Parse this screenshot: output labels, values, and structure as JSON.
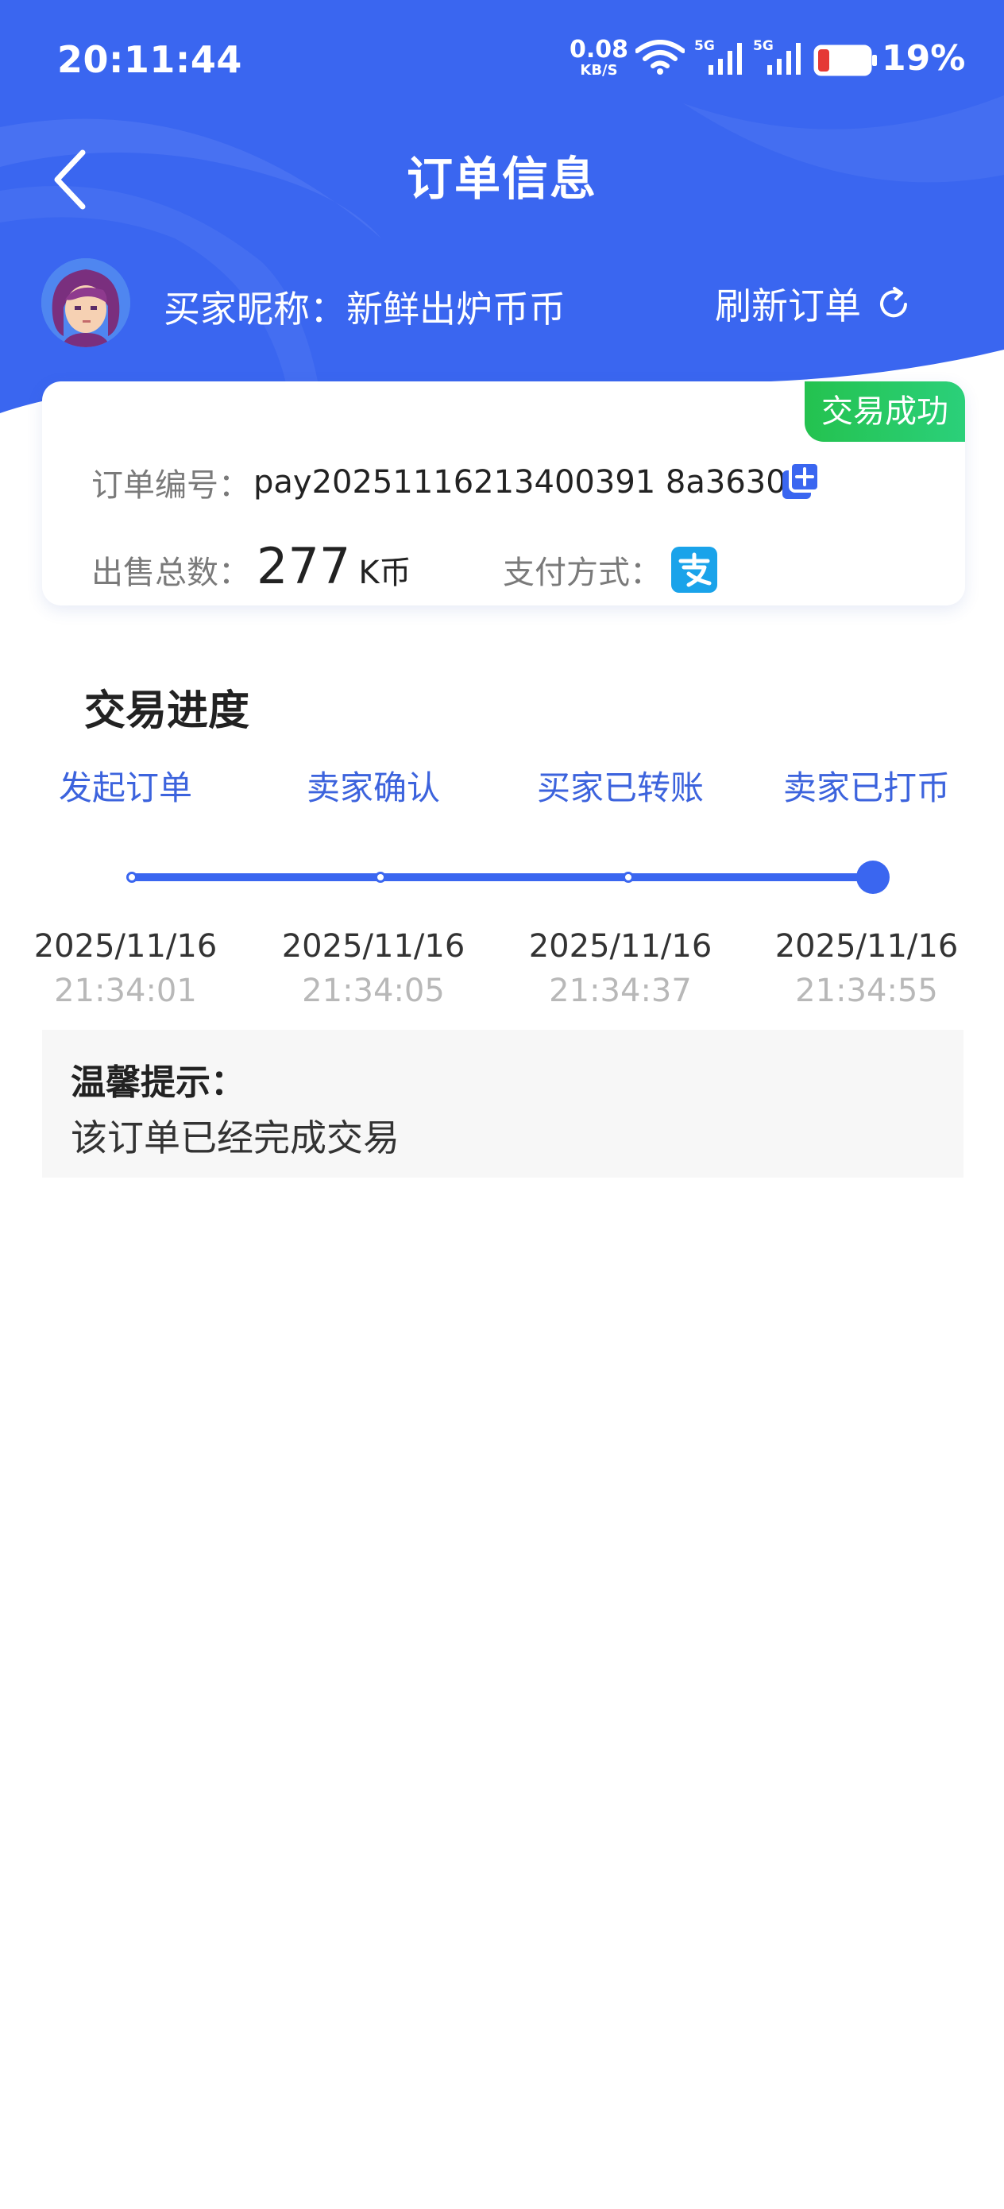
{
  "status_bar": {
    "time": "20:11:44",
    "net_speed_value": "0.08",
    "net_speed_unit": "KB/S",
    "signal_1_label": "5G",
    "signal_2_label": "5G",
    "battery_percent": "19%"
  },
  "nav": {
    "title": "订单信息"
  },
  "buyer": {
    "label": "买家昵称：新鲜出炉币币",
    "refresh_label": "刷新订单"
  },
  "order": {
    "status_tag": "交易成功",
    "order_no_label": "订单编号：",
    "order_no": "pay20251116213400391 8a3630",
    "total_label": "出售总数：",
    "total_amount": "277",
    "total_unit": "K币",
    "pay_method_label": "支付方式：",
    "pay_method_icon": "alipay-icon"
  },
  "progress": {
    "title": "交易进度",
    "steps": [
      {
        "label": "发起订单",
        "date": "2025/11/16",
        "time": "21:34:01"
      },
      {
        "label": "卖家确认",
        "date": "2025/11/16",
        "time": "21:34:05"
      },
      {
        "label": "买家已转账",
        "date": "2025/11/16",
        "time": "21:34:37"
      },
      {
        "label": "卖家已打币",
        "date": "2025/11/16",
        "time": "21:34:55"
      }
    ],
    "current_step": 4
  },
  "tip": {
    "title": "温馨提示：",
    "text": "该订单已经完成交易"
  },
  "colors": {
    "brand_blue": "#3a66f0",
    "success_green": "#24c24f",
    "step_label_blue": "#3c63dd"
  }
}
